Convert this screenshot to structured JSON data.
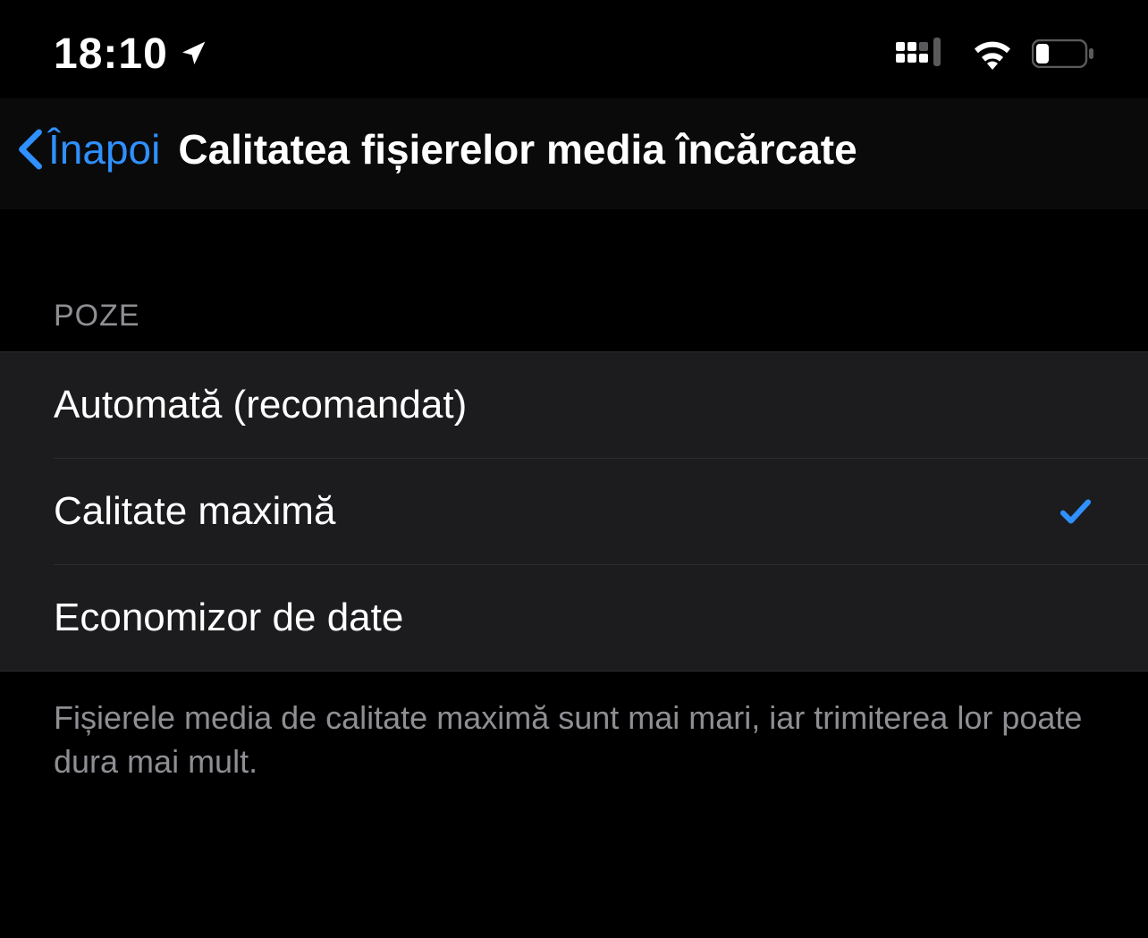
{
  "statusBar": {
    "time": "18:10"
  },
  "nav": {
    "backLabel": "Înapoi",
    "title": "Calitatea fișierelor media încărcate"
  },
  "section": {
    "header": "POZE",
    "options": [
      {
        "label": "Automată (recomandat)",
        "selected": false
      },
      {
        "label": "Calitate maximă",
        "selected": true
      },
      {
        "label": "Economizor de date",
        "selected": false
      }
    ],
    "footer": "Fișierele media de calitate maximă sunt mai mari, iar trimiterea lor poate dura mai mult."
  }
}
